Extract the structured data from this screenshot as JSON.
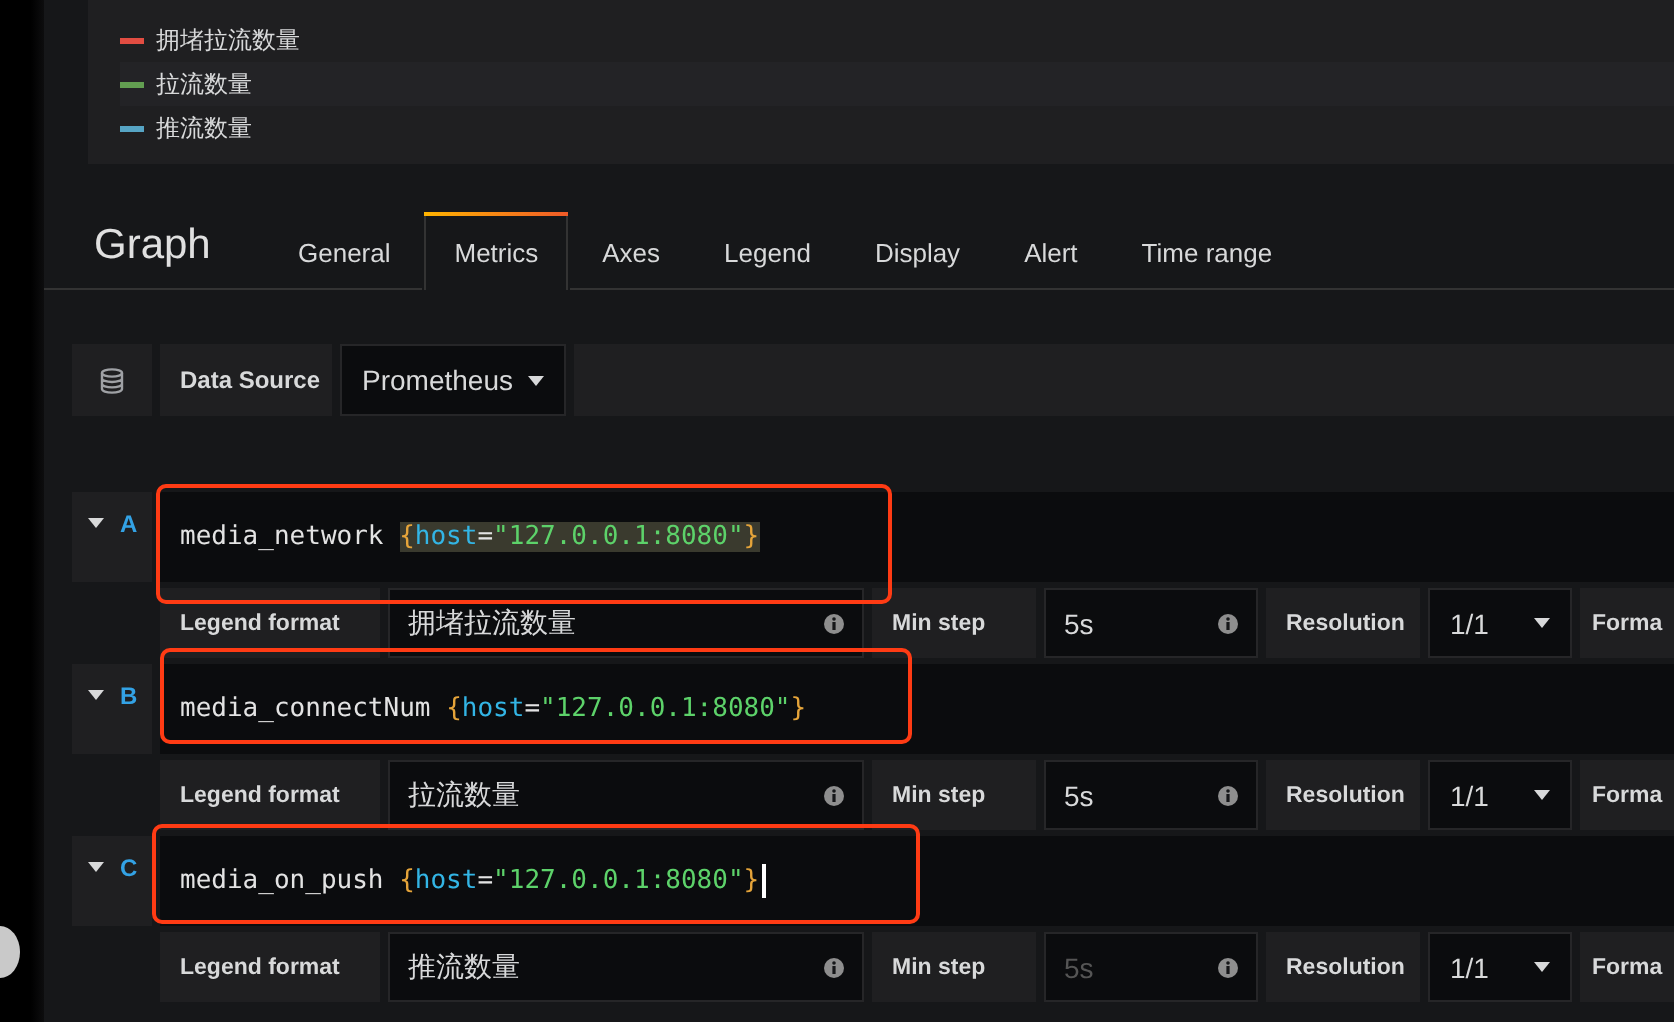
{
  "legend": [
    {
      "label": "拥堵拉流数量",
      "color": "#e24d42"
    },
    {
      "label": "拉流数量",
      "color": "#629e51"
    },
    {
      "label": "推流数量",
      "color": "#56a4c4"
    }
  ],
  "editor": {
    "title": "Graph"
  },
  "tabs": [
    {
      "label": "General",
      "selected": false
    },
    {
      "label": "Metrics",
      "selected": true
    },
    {
      "label": "Axes",
      "selected": false
    },
    {
      "label": "Legend",
      "selected": false
    },
    {
      "label": "Display",
      "selected": false
    },
    {
      "label": "Alert",
      "selected": false
    },
    {
      "label": "Time range",
      "selected": false
    }
  ],
  "data_source": {
    "label": "Data Source",
    "value": "Prometheus"
  },
  "queries": [
    {
      "ref": "A",
      "expanded": true,
      "tokens": [
        {
          "kind": "metric",
          "text": "media_network"
        },
        {
          "kind": "brace",
          "text": "{"
        },
        {
          "kind": "key",
          "text": "host"
        },
        {
          "kind": "op",
          "text": "="
        },
        {
          "kind": "string",
          "text": "\"127.0.0.1:8080\""
        },
        {
          "kind": "brace",
          "text": "}"
        }
      ],
      "highlighted": true,
      "selector_highlighted": true,
      "cursor": false,
      "legend_label": "Legend format",
      "legend_value": "拥堵拉流数量",
      "min_step_label": "Min step",
      "min_step": {
        "value": "5s"
      },
      "resolution_label": "Resolution",
      "resolution": "1/1",
      "format_label": "Forma"
    },
    {
      "ref": "B",
      "expanded": true,
      "tokens": [
        {
          "kind": "metric",
          "text": "media_connectNum"
        },
        {
          "kind": "brace",
          "text": "{"
        },
        {
          "kind": "key",
          "text": "host"
        },
        {
          "kind": "op",
          "text": "="
        },
        {
          "kind": "string",
          "text": "\"127.0.0.1:8080\""
        },
        {
          "kind": "brace",
          "text": "}"
        }
      ],
      "highlighted": true,
      "selector_highlighted": false,
      "cursor": false,
      "legend_label": "Legend format",
      "legend_value": "拉流数量",
      "min_step_label": "Min step",
      "min_step": {
        "value": "5s"
      },
      "resolution_label": "Resolution",
      "resolution": "1/1",
      "format_label": "Forma"
    },
    {
      "ref": "C",
      "expanded": true,
      "tokens": [
        {
          "kind": "metric",
          "text": "media_on_push"
        },
        {
          "kind": "brace",
          "text": "{"
        },
        {
          "kind": "key",
          "text": "host"
        },
        {
          "kind": "op",
          "text": "="
        },
        {
          "kind": "string",
          "text": "\"127.0.0.1:8080\""
        },
        {
          "kind": "brace",
          "text": "}"
        }
      ],
      "highlighted": true,
      "selector_highlighted": false,
      "cursor": true,
      "legend_label": "Legend format",
      "legend_value": "推流数量",
      "min_step_label": "Min step",
      "min_step": {
        "placeholder": "5s"
      },
      "resolution_label": "Resolution",
      "resolution": "1/1",
      "format_label": "Forma"
    }
  ]
}
